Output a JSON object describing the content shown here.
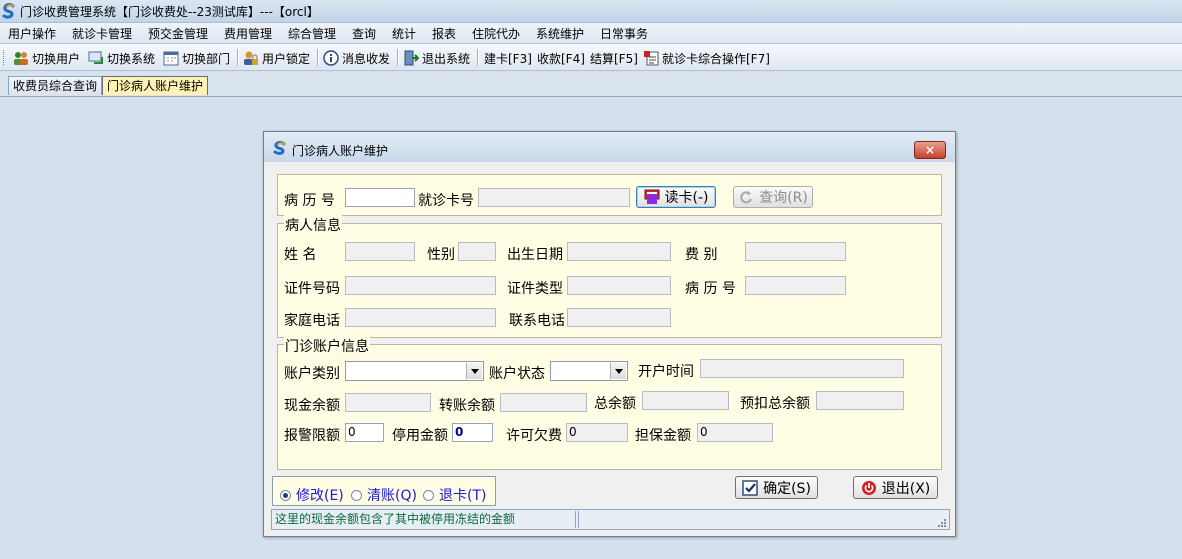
{
  "window": {
    "title": "门诊收费管理系统【门诊收费处--23测试库】---【orcl】"
  },
  "menu": [
    "用户操作",
    "就诊卡管理",
    "预交金管理",
    "费用管理",
    "综合管理",
    "查询",
    "统计",
    "报表",
    "住院代办",
    "系统维护",
    "日常事务"
  ],
  "toolbar": {
    "switch_user": "切换用户",
    "switch_system": "切换系统",
    "switch_dept": "切换部门",
    "user_lock": "用户锁定",
    "message": "消息收发",
    "exit_system": "退出系统",
    "create_card": "建卡[F3]",
    "charge": "收款[F4]",
    "settle": "结算[F5]",
    "card_ops": "就诊卡综合操作[F7]"
  },
  "tabs": [
    {
      "label": "收费员综合查询",
      "active": false
    },
    {
      "label": "门诊病人账户维护",
      "active": true
    }
  ],
  "dialog": {
    "title": "门诊病人账户维护",
    "close": "×",
    "search": {
      "record_no_label": "病 历 号",
      "record_no_value": "",
      "card_no_label": "就诊卡号",
      "card_no_value": "",
      "read_card_button": "读卡(-)",
      "query_button": "查询(R)"
    },
    "patient": {
      "legend": "病人信息",
      "name_label": "姓    名",
      "name_value": "",
      "sex_label": "性别",
      "sex_value": "",
      "birth_label": "出生日期",
      "birth_value": "",
      "fee_type_label": "费    别",
      "fee_type_value": "",
      "id_no_label": "证件号码",
      "id_no_value": "",
      "id_type_label": "证件类型",
      "id_type_value": "",
      "record_no_label": "病 历 号",
      "record_no_value": "",
      "home_phone_label": "家庭电话",
      "home_phone_value": "",
      "contact_phone_label": "联系电话",
      "contact_phone_value": ""
    },
    "account": {
      "legend": "门诊账户信息",
      "acct_type_label": "账户类别",
      "acct_type_value": "",
      "acct_status_label": "账户状态",
      "acct_status_value": "",
      "open_time_label": "开户时间",
      "open_time_value": "",
      "cash_balance_label": "现金余额",
      "cash_balance_value": "",
      "transfer_balance_label": "转账余额",
      "transfer_balance_value": "",
      "total_balance_label": "总余额",
      "total_balance_value": "",
      "prededuct_total_label": "预扣总余额",
      "prededuct_total_value": "",
      "alert_limit_label": "报警限额",
      "alert_limit_value": "0",
      "stop_amount_label": "停用金额",
      "stop_amount_value": "0",
      "overdraft_label": "许可欠费",
      "overdraft_value": "0",
      "guarantee_label": "担保金额",
      "guarantee_value": "0"
    },
    "modes": [
      {
        "label": "修改(E)",
        "checked": true
      },
      {
        "label": "清账(Q)",
        "checked": false
      },
      {
        "label": "退卡(T)",
        "checked": false
      }
    ],
    "ok_button": "确定(S)",
    "exit_button": "退出(X)",
    "status_text": "这里的现金余额包含了其中被停用冻结的金额"
  }
}
